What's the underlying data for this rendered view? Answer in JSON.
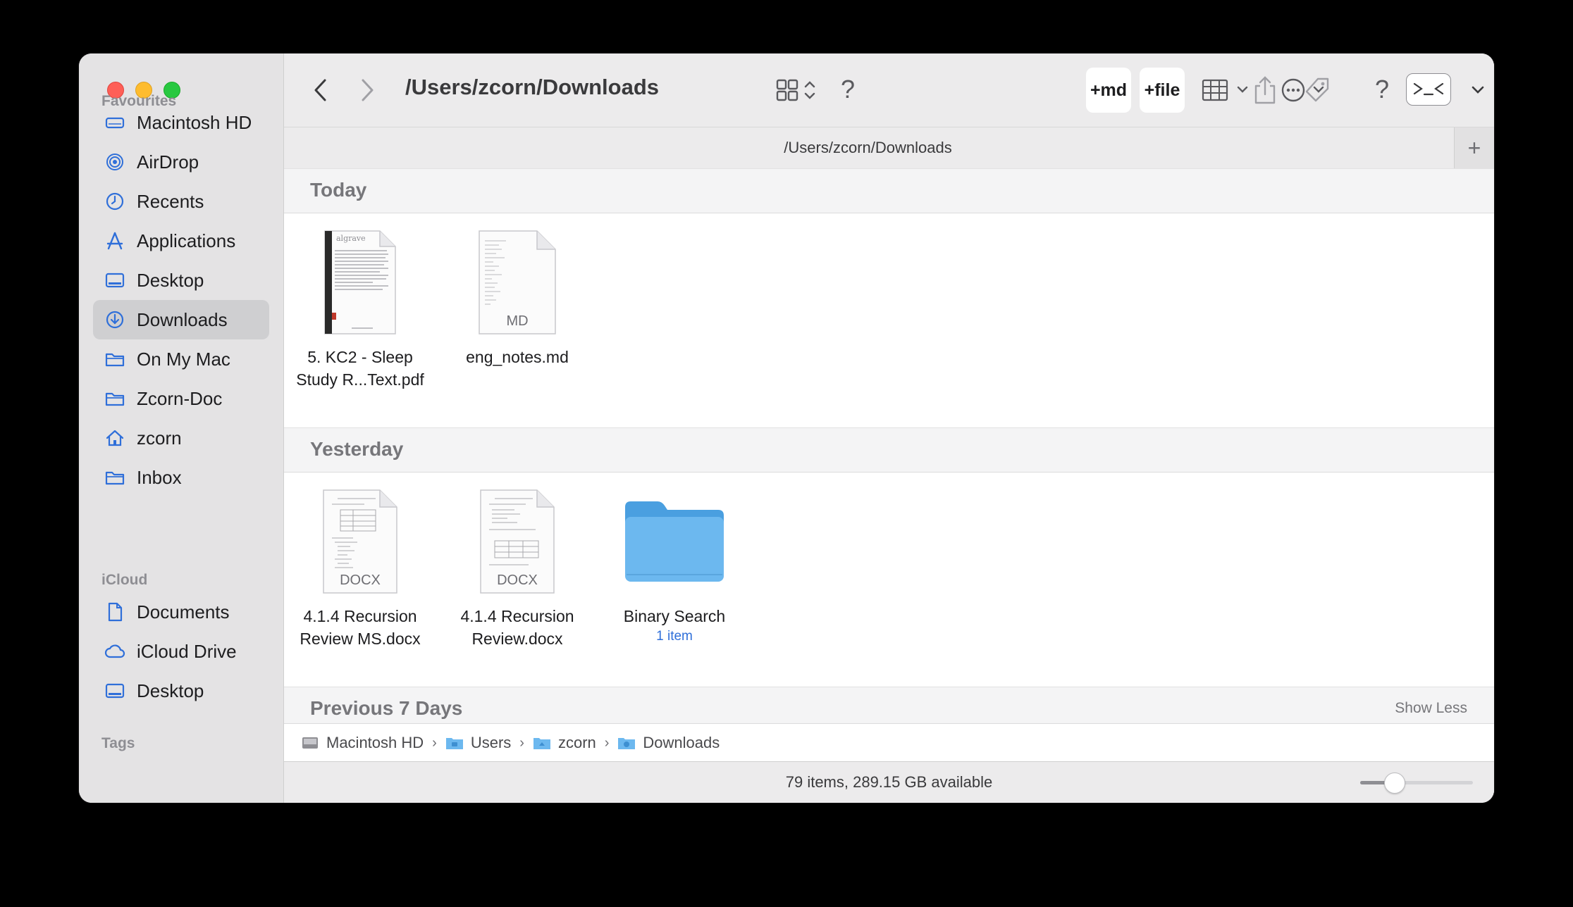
{
  "sidebar": {
    "favourites_label": "Favourites",
    "favourites": [
      {
        "label": "Macintosh HD",
        "icon": "drive-icon"
      },
      {
        "label": "AirDrop",
        "icon": "airdrop-icon"
      },
      {
        "label": "Recents",
        "icon": "clock-icon"
      },
      {
        "label": "Applications",
        "icon": "applications-icon"
      },
      {
        "label": "Desktop",
        "icon": "desktop-icon"
      },
      {
        "label": "Downloads",
        "icon": "download-icon",
        "selected": true
      },
      {
        "label": "On My Mac",
        "icon": "folder-icon"
      },
      {
        "label": "Zcorn-Doc",
        "icon": "folder-icon"
      },
      {
        "label": "zcorn",
        "icon": "home-icon"
      },
      {
        "label": "Inbox",
        "icon": "folder-icon"
      }
    ],
    "icloud_label": "iCloud",
    "icloud": [
      {
        "label": "Documents",
        "icon": "document-icon"
      },
      {
        "label": "iCloud Drive",
        "icon": "cloud-icon"
      },
      {
        "label": "Desktop",
        "icon": "desktop-icon"
      }
    ],
    "tags_label": "Tags"
  },
  "toolbar": {
    "title": "/Users/zcorn/Downloads",
    "help_label": "?",
    "new_md_label": "+md",
    "new_file_label": "+file",
    "help2_label": "?"
  },
  "tab": {
    "title": "/Users/zcorn/Downloads",
    "add_label": "+"
  },
  "groups": {
    "today": {
      "title": "Today",
      "files": [
        {
          "name_line1": "5. KC2 - Sleep",
          "name_line2": "Study R...Text.pdf",
          "kind": "pdf",
          "badge": "",
          "thumb_word": "algrave"
        },
        {
          "name_line1": "eng_notes.md",
          "name_line2": "",
          "kind": "md",
          "badge": "MD"
        }
      ]
    },
    "yesterday": {
      "title": "Yesterday",
      "files": [
        {
          "name_line1": "4.1.4 Recursion",
          "name_line2": "Review MS.docx",
          "kind": "docx",
          "badge": "DOCX"
        },
        {
          "name_line1": "4.1.4 Recursion",
          "name_line2": "Review.docx",
          "kind": "docx",
          "badge": "DOCX"
        },
        {
          "name_line1": "Binary Search",
          "name_line2": "",
          "kind": "folder",
          "sub": "1 item"
        }
      ]
    },
    "previous": {
      "title": "Previous 7 Days",
      "action": "Show Less"
    }
  },
  "pathbar": {
    "crumbs": [
      "Macintosh HD",
      "Users",
      "zcorn",
      "Downloads"
    ],
    "separator": "›"
  },
  "status": {
    "text": "79 items, 289.15 GB available",
    "zoom_fraction": 0.3
  },
  "colors": {
    "accent": "#2f6fd9",
    "folder": "#6cb8ef",
    "close": "#fe5f57",
    "minimize": "#febc2e",
    "maximize": "#28c840"
  }
}
